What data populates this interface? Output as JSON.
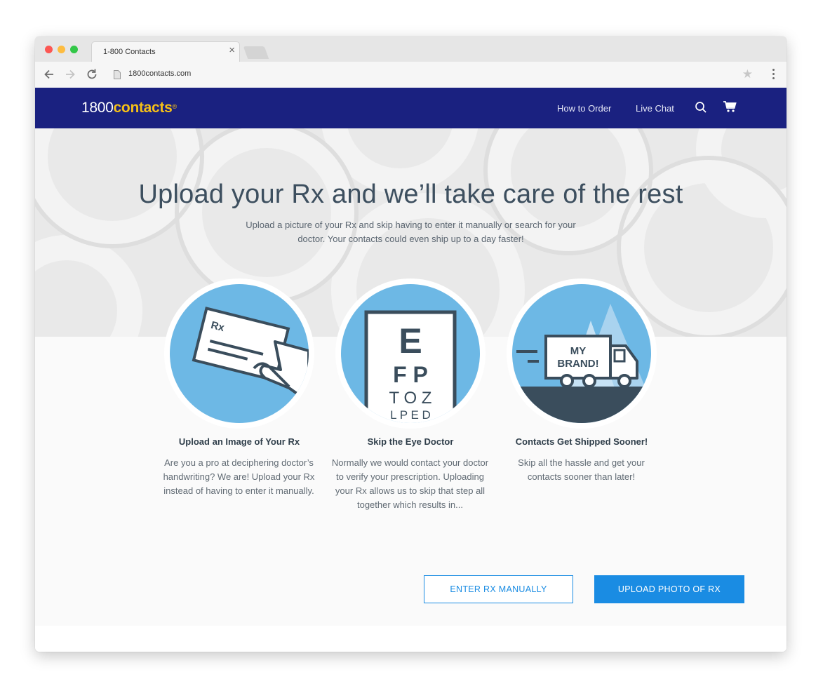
{
  "browser": {
    "tab_title": "1-800 Contacts",
    "tab_close": "×",
    "url": "1800contacts.com",
    "star": "★"
  },
  "site": {
    "logo_number": "1800",
    "logo_word": "contacts",
    "logo_mark": "®",
    "nav": {
      "how_to_order": "How to Order",
      "live_chat": "Live Chat"
    },
    "icons": [
      "search-icon",
      "cart-icon"
    ]
  },
  "hero": {
    "title": "Upload your Rx and we’ll take care of the rest",
    "subtitle": "Upload a picture of your Rx and skip having to enter it manually or search for your doctor. Your contacts could even ship up to a day faster!"
  },
  "features": [
    {
      "heading": "Upload an Image of Your Rx",
      "body": "Are you a pro at deciphering doctor’s handwriting? We are! Upload your Rx instead of having to enter it manually.",
      "card_text": "Rx"
    },
    {
      "heading": "Skip the Eye Doctor",
      "body": "Normally we would contact your doctor to verify your prescription. Uploading your Rx allows us to skip that step all together which results in...",
      "chart_rows": [
        "E",
        "F P",
        "T O Z",
        "L P E D"
      ]
    },
    {
      "heading": "Contacts Get Shipped Sooner!",
      "body": "Skip all the hassle and get your contacts sooner than later!",
      "truck_text_1": "MY",
      "truck_text_2": "BRAND!"
    }
  ],
  "actions": {
    "enter_manually": "ENTER RX MANUALLY",
    "upload_photo": "UPLOAD PHOTO OF RX"
  },
  "colors": {
    "header_bg": "#1a2180",
    "logo_accent": "#f6c017",
    "accent_blue": "#1a8ce3",
    "illustration_blue": "#6db8e5",
    "dark_slate": "#3d4f5f"
  }
}
